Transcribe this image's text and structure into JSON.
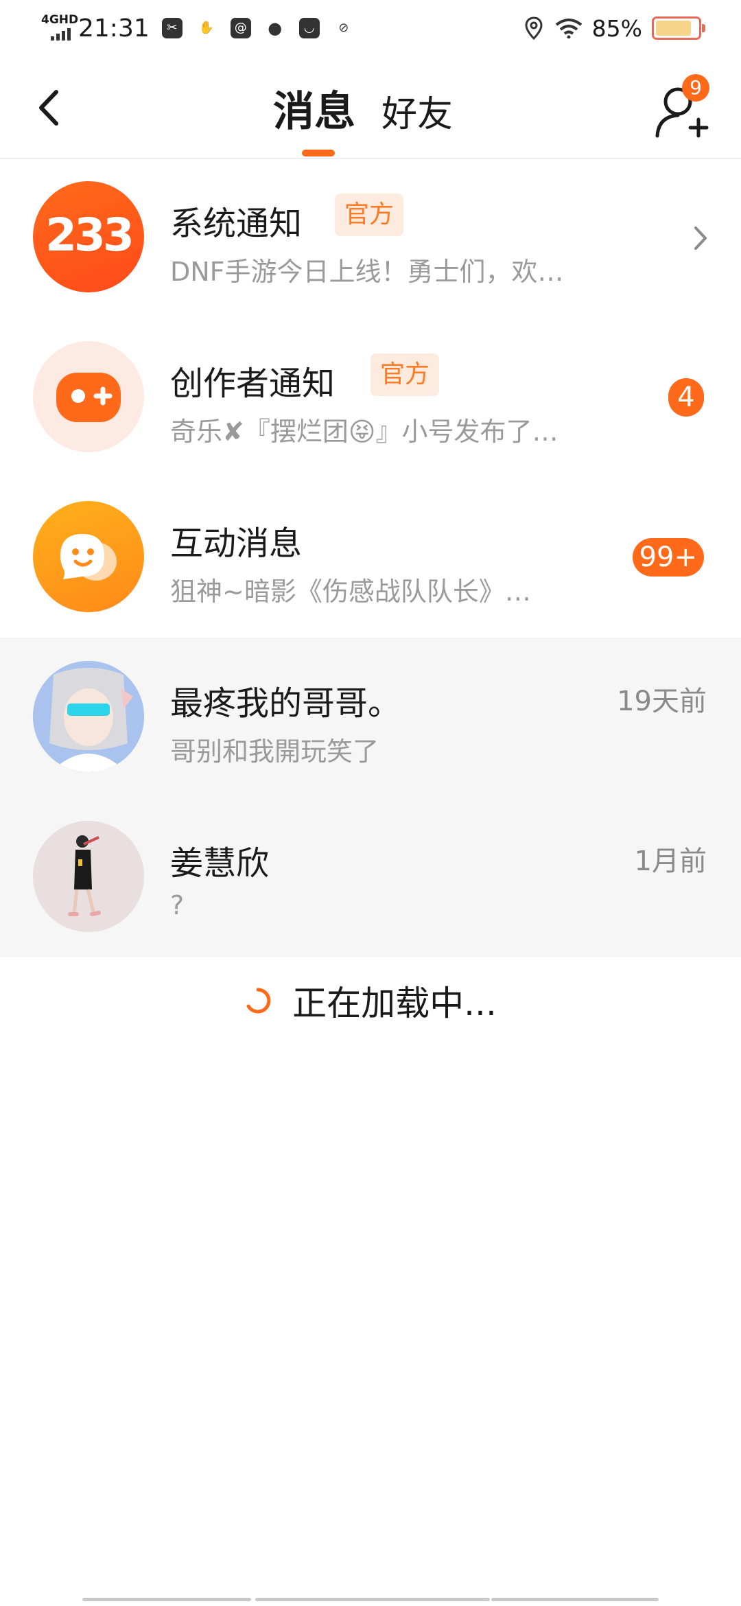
{
  "status_bar": {
    "network": "4GHD",
    "time": "21:31",
    "battery": "85%",
    "battery_level": 0.85,
    "app_icons": [
      "cut-icon",
      "handshake-icon",
      "at-icon",
      "wechat-icon",
      "bag-icon",
      "leaf-icon"
    ]
  },
  "header": {
    "tab_messages": "消息",
    "tab_friends": "好友",
    "friend_requests": "9"
  },
  "messages": [
    {
      "title": "系统通知",
      "tag": "官方",
      "preview": "DNF手游今日上线！勇士们，欢…",
      "avatar_text": "233",
      "avatar_color": "#ff5a1f"
    },
    {
      "title": "创作者通知",
      "tag": "官方",
      "preview": "奇乐✘『摆烂团😝』小号发布了…",
      "badge": "4",
      "avatar_color": "#fdebe3"
    },
    {
      "title": "互动消息",
      "preview": "狙神~暗影《伤感战队队长》…",
      "badge": "99+",
      "avatar_color": "#ff9a1a"
    },
    {
      "title": "最疼我的哥哥。",
      "preview": "哥别和我開玩笑了",
      "time": "19天前"
    },
    {
      "title": "姜慧欣",
      "preview": "?",
      "time": "1月前"
    }
  ],
  "loading_text": "正在加载中...",
  "colors": {
    "accent": "#ff6a1a",
    "tag_bg": "#fdebe0",
    "personal_row_bg": "#f6f6f6"
  }
}
